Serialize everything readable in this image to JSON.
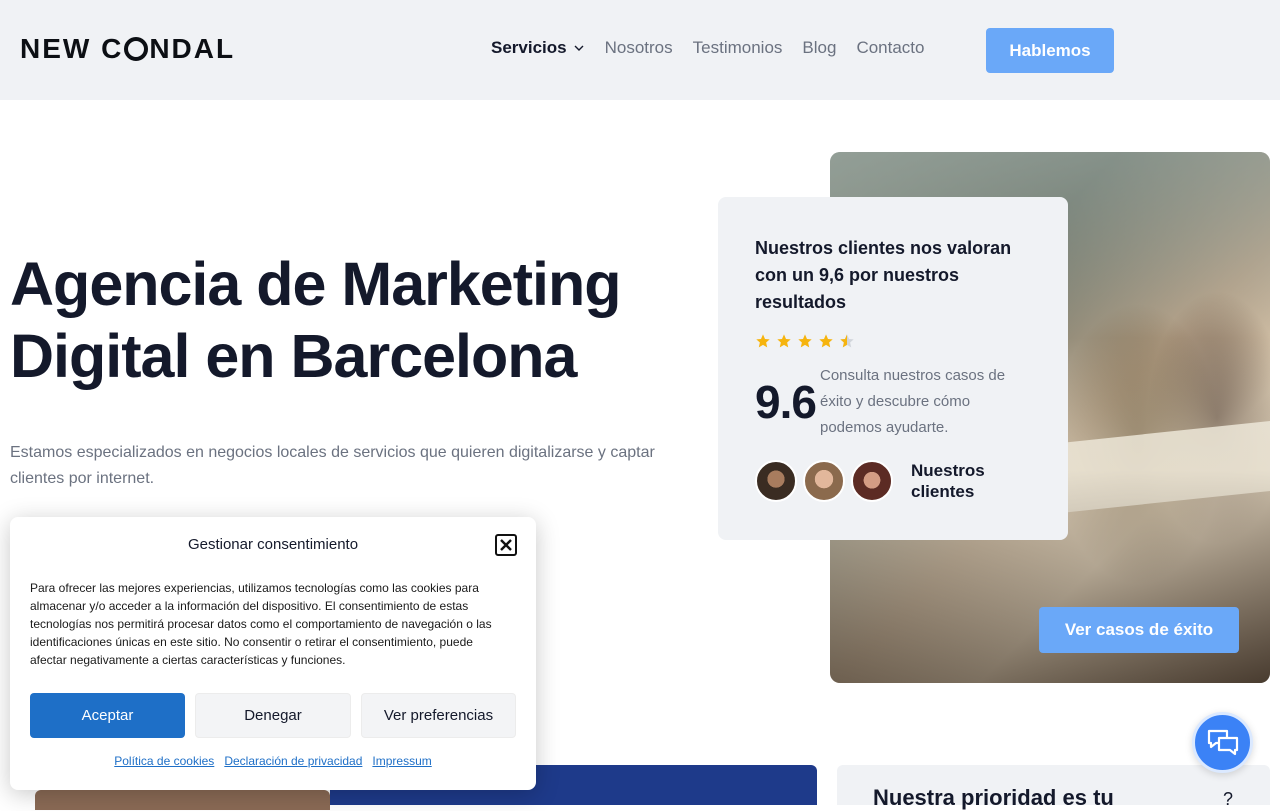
{
  "header": {
    "logo_part1": "NEW C",
    "logo_part2": "NDAL",
    "nav": [
      {
        "label": "Servicios",
        "active": true
      },
      {
        "label": "Nosotros"
      },
      {
        "label": "Testimonios"
      },
      {
        "label": "Blog"
      },
      {
        "label": "Contacto"
      }
    ],
    "cta_label": "Hablemos"
  },
  "hero": {
    "title_line1": "Agencia de Marketing",
    "title_line2": "Digital en Barcelona",
    "subtitle": "Estamos especializados en negocios locales de servicios que quieren digitalizarse y captar clientes por internet."
  },
  "rating_card": {
    "title": "Nuestros clientes nos valoran con un 9,6 por nuestros resultados",
    "stars": 4.5,
    "score": "9.6",
    "score_text": "Consulta nuestros casos de éxito y descubre cómo podemos ayudarte.",
    "clients_label": "Nuestros clientes"
  },
  "photo_button_label": "Ver casos de éxito",
  "bottom_card_title": "Nuestra prioridad es tu",
  "bottom_card_extra": "?",
  "consent": {
    "title": "Gestionar consentimiento",
    "body": "Para ofrecer las mejores experiencias, utilizamos tecnologías como las cookies para almacenar y/o acceder a la información del dispositivo. El consentimiento de estas tecnologías nos permitirá procesar datos como el comportamiento de navegación o las identificaciones únicas en este sitio. No consentir o retirar el consentimiento, puede afectar negativamente a ciertas características y funciones.",
    "accept_label": "Aceptar",
    "deny_label": "Denegar",
    "prefs_label": "Ver preferencias",
    "links": [
      "Política de cookies",
      "Declaración de privacidad",
      "Impressum"
    ]
  },
  "colors": {
    "accent": "#6aa8f8",
    "primary_button": "#1e6fc7",
    "dark_text": "#14192b",
    "star": "#f6b40e"
  }
}
